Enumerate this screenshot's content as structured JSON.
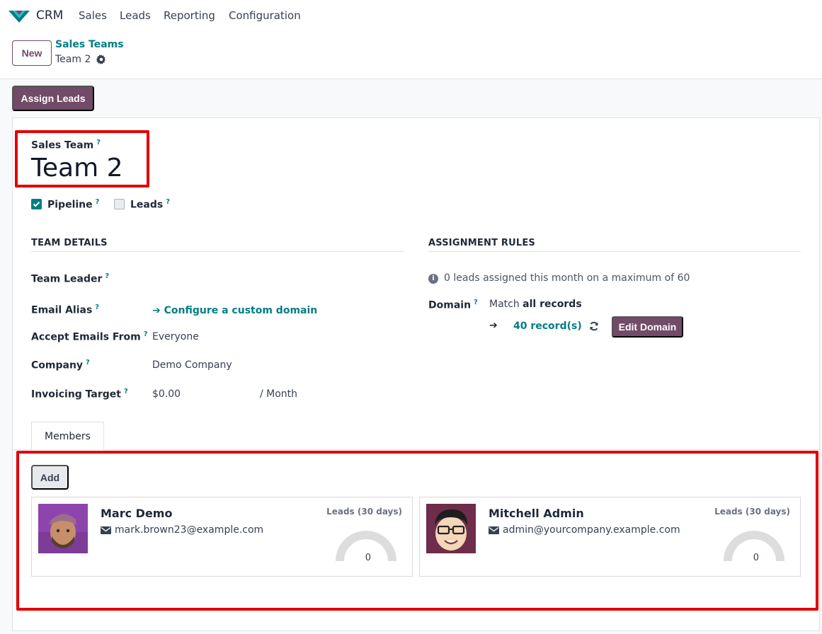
{
  "navbar": {
    "app_name": "CRM",
    "menu": [
      "Sales",
      "Leads",
      "Reporting",
      "Configuration"
    ]
  },
  "control_panel": {
    "new_button": "New",
    "breadcrumb_parent": "Sales Teams",
    "breadcrumb_current": "Team 2"
  },
  "actions": {
    "assign_leads": "Assign Leads"
  },
  "form": {
    "sales_team_label": "Sales Team",
    "help_marker": "?",
    "team_name": "Team 2",
    "pipeline": {
      "label": "Pipeline",
      "checked": true
    },
    "leads": {
      "label": "Leads",
      "checked": false
    },
    "team_details": {
      "heading": "TEAM DETAILS",
      "team_leader_label": "Team Leader",
      "team_leader_value": "",
      "email_alias_label": "Email Alias",
      "email_alias_link": "Configure a custom domain",
      "accept_emails_label": "Accept Emails From",
      "accept_emails_value": "Everyone",
      "company_label": "Company",
      "company_value": "Demo Company",
      "invoicing_label": "Invoicing Target",
      "invoicing_value": "$0.00",
      "invoicing_period": "/ Month"
    },
    "assignment_rules": {
      "heading": "ASSIGNMENT RULES",
      "info": "0 leads assigned this month on a maximum of 60",
      "domain_label": "Domain",
      "match_prefix": "Match",
      "match_bold": "all records",
      "records_link": "40 record(s)",
      "edit_domain": "Edit Domain"
    }
  },
  "tabs": {
    "members": "Members"
  },
  "members": {
    "add_button": "Add",
    "cards": [
      {
        "name": "Marc Demo",
        "email": "mark.brown23@example.com",
        "leads_label": "Leads (30 days)",
        "leads_value": "0"
      },
      {
        "name": "Mitchell Admin",
        "email": "admin@yourcompany.example.com",
        "leads_label": "Leads (30 days)",
        "leads_value": "0"
      }
    ]
  },
  "colors": {
    "brand": "#714b67",
    "link": "#017e84",
    "highlight": "#e20000"
  }
}
